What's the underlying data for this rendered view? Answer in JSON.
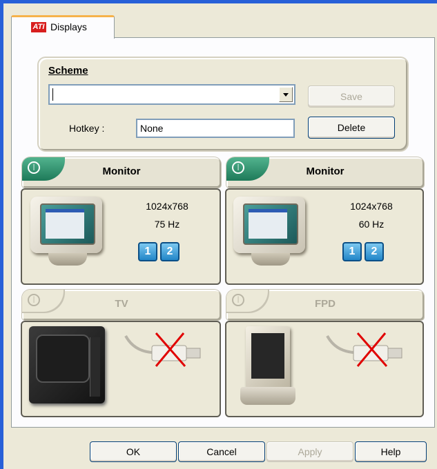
{
  "tab": {
    "label": "Displays",
    "logo_text": "ATI"
  },
  "scheme": {
    "title": "Scheme",
    "selected_value": "",
    "save_label": "Save",
    "delete_label": "Delete",
    "hotkey_label": "Hotkey :",
    "hotkey_value": "None"
  },
  "displays": [
    {
      "name": "Monitor",
      "enabled": true,
      "resolution": "1024x768",
      "refresh": "75 Hz",
      "chips": [
        "1",
        "2"
      ]
    },
    {
      "name": "Monitor",
      "enabled": true,
      "resolution": "1024x768",
      "refresh": "60 Hz",
      "chips": [
        "1",
        "2"
      ]
    },
    {
      "name": "TV",
      "enabled": false
    },
    {
      "name": "FPD",
      "enabled": false
    }
  ],
  "buttons": {
    "ok": "OK",
    "cancel": "Cancel",
    "apply": "Apply",
    "help": "Help"
  },
  "colors": {
    "frame_blue": "#2860d8",
    "tab_accent": "#f6b24a",
    "power_green": "#1e7a59",
    "chip_blue": "#2286c8",
    "disabled_gray": "#aca899"
  }
}
